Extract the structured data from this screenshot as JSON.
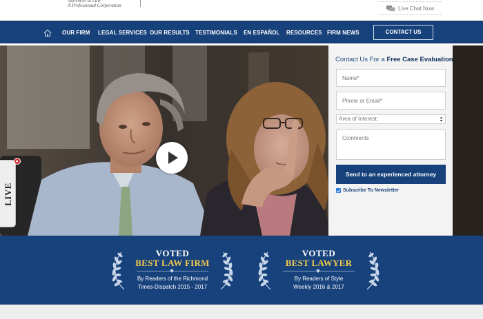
{
  "header": {
    "tagline_line1": "Attorneys at Law",
    "tagline_line2": "A Professional Corporation",
    "live_chat_now": "Live Chat Now"
  },
  "nav": {
    "items": [
      {
        "label": "OUR FIRM"
      },
      {
        "label": "LEGAL SERVICES"
      },
      {
        "label": "OUR RESULTS"
      },
      {
        "label": "TESTIMONIALS"
      },
      {
        "label": "EN ESPAÑOL"
      },
      {
        "label": "RESOURCES"
      },
      {
        "label": "FIRM NEWS"
      }
    ],
    "contact_us": "CONTACT US",
    "home_icon": "home-icon"
  },
  "hero": {
    "play_icon": "play-icon",
    "live_chat_tab": "LIVE CHAT"
  },
  "form": {
    "title_prefix": "Contact Us For a ",
    "title_bold": "Free Case Evaluation",
    "name_placeholder": "Name*",
    "phone_placeholder": "Phone or Email*",
    "area_placeholder": "Area of Interest:",
    "comments_placeholder": "Comments",
    "submit_label": "Send to an experienced attorney",
    "subscribe_label": "Subscribe To Newsletter",
    "subscribe_checked": true
  },
  "awards": [
    {
      "voted": "VOTED",
      "title": "BEST LAW FIRM",
      "line1": "By Readers of the Richmond",
      "line2": "Times-Dispatch  2015 - 2017"
    },
    {
      "voted": "VOTED",
      "title": "BEST LAWYER",
      "line1": "By Readers of Style",
      "line2": "Weekly 2016 & 2017"
    }
  ],
  "colors": {
    "nav_blue": "#16417a",
    "gold": "#f2c94c",
    "live_chat_badge": "#d8303a"
  }
}
